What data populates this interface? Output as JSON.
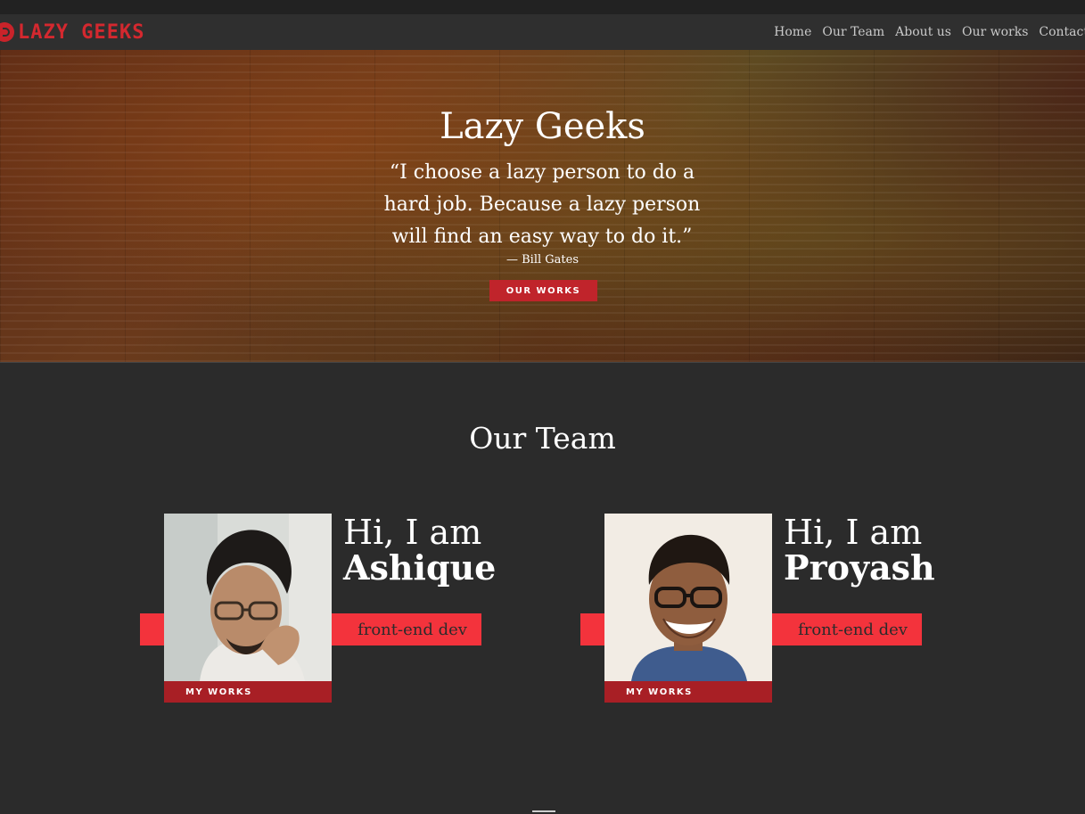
{
  "nav": {
    "logo_text": "LAZY GEEKS",
    "links": [
      "Home",
      "Our Team",
      "About us",
      "Our works",
      "Contact"
    ]
  },
  "hero": {
    "title": "Lazy Geeks",
    "quote": "“I choose a lazy person to do a hard job. Because a lazy person will find an easy way to do it.”",
    "author": "— Bill Gates",
    "button": "OUR WORKS"
  },
  "team": {
    "heading": "Our Team",
    "members": [
      {
        "greeting": "Hi, I am",
        "name": "Ashique",
        "role": "front-end dev",
        "button": "MY WORKS"
      },
      {
        "greeting": "Hi, I am",
        "name": "Proyash",
        "role": "front-end dev",
        "button": "MY WORKS"
      }
    ]
  },
  "colors": {
    "accent": "#f3333c",
    "accent_dark": "#a81f25",
    "background": "#2b2b2b",
    "navbar": "#2f2f2f"
  }
}
